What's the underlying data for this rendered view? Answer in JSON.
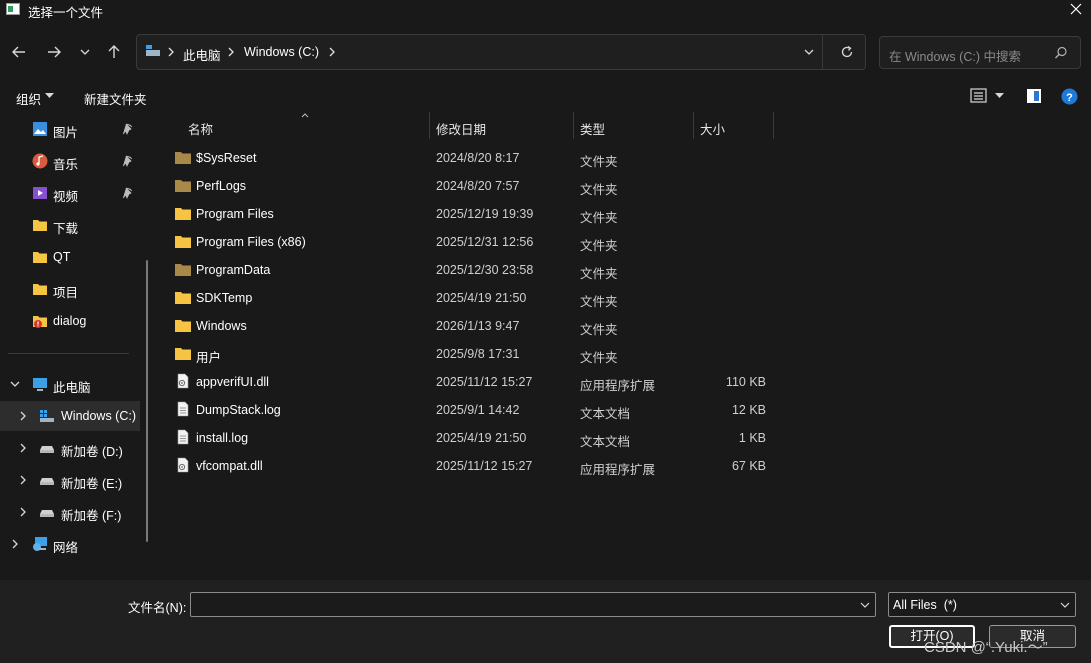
{
  "window": {
    "title": "选择一个文件"
  },
  "address": {
    "segments": [
      "此电脑",
      "Windows (C:)"
    ]
  },
  "search": {
    "placeholder": "在 Windows (C:) 中搜索"
  },
  "toolbar": {
    "organize": "组织",
    "new_folder": "新建文件夹"
  },
  "sidebar": {
    "quick": [
      {
        "label": "图片",
        "icon": "pictures-icon",
        "pinned": true
      },
      {
        "label": "音乐",
        "icon": "music-icon",
        "pinned": true
      },
      {
        "label": "视频",
        "icon": "videos-icon",
        "pinned": true
      },
      {
        "label": "下载",
        "icon": "folder-icon",
        "pinned": false
      },
      {
        "label": "QT",
        "icon": "folder-icon",
        "pinned": false
      },
      {
        "label": "项目",
        "icon": "folder-icon",
        "pinned": false
      },
      {
        "label": "dialog",
        "icon": "folder-warning-icon",
        "pinned": false
      }
    ],
    "tree": [
      {
        "label": "此电脑",
        "icon": "this-pc-icon",
        "expanded": true
      },
      {
        "label": "Windows (C:)",
        "icon": "windows-drive-icon",
        "selected": true
      },
      {
        "label": "新加卷 (D:)",
        "icon": "drive-icon"
      },
      {
        "label": "新加卷 (E:)",
        "icon": "drive-icon"
      },
      {
        "label": "新加卷 (F:)",
        "icon": "drive-icon"
      },
      {
        "label": "网络",
        "icon": "network-icon"
      }
    ]
  },
  "columns": {
    "name": "名称",
    "date": "修改日期",
    "type": "类型",
    "size": "大小"
  },
  "files": [
    {
      "name": "$SysReset",
      "date": "2024/8/20 8:17",
      "type": "文件夹",
      "size": "",
      "icon": "folder-dim-icon"
    },
    {
      "name": "PerfLogs",
      "date": "2024/8/20 7:57",
      "type": "文件夹",
      "size": "",
      "icon": "folder-dim-icon"
    },
    {
      "name": "Program Files",
      "date": "2025/12/19 19:39",
      "type": "文件夹",
      "size": "",
      "icon": "folder-icon"
    },
    {
      "name": "Program Files (x86)",
      "date": "2025/12/31 12:56",
      "type": "文件夹",
      "size": "",
      "icon": "folder-icon"
    },
    {
      "name": "ProgramData",
      "date": "2025/12/30 23:58",
      "type": "文件夹",
      "size": "",
      "icon": "folder-dim-icon"
    },
    {
      "name": "SDKTemp",
      "date": "2025/4/19 21:50",
      "type": "文件夹",
      "size": "",
      "icon": "folder-icon"
    },
    {
      "name": "Windows",
      "date": "2026/1/13 9:47",
      "type": "文件夹",
      "size": "",
      "icon": "folder-icon"
    },
    {
      "name": "用户",
      "date": "2025/9/8 17:31",
      "type": "文件夹",
      "size": "",
      "icon": "folder-icon"
    },
    {
      "name": "appverifUI.dll",
      "date": "2025/11/12 15:27",
      "type": "应用程序扩展",
      "size": "110 KB",
      "icon": "dll-file-icon"
    },
    {
      "name": "DumpStack.log",
      "date": "2025/9/1 14:42",
      "type": "文本文档",
      "size": "12 KB",
      "icon": "text-file-icon"
    },
    {
      "name": "install.log",
      "date": "2025/4/19 21:50",
      "type": "文本文档",
      "size": "1 KB",
      "icon": "text-file-icon"
    },
    {
      "name": "vfcompat.dll",
      "date": "2025/11/12 15:27",
      "type": "应用程序扩展",
      "size": "67 KB",
      "icon": "dll-file-icon"
    }
  ],
  "bottom": {
    "filename_label": "文件名(N):",
    "filename_value": "",
    "filter_value": "All Files  (*)",
    "open_label": "打开(O)",
    "cancel_label": "取消"
  },
  "watermark": "CSDN @“.Yuki.～”",
  "colors": {
    "folder": "#f4c442",
    "folder_dim": "#a8894a",
    "help": "#1e7ad8",
    "accent_pc": "#3aa0e8"
  }
}
